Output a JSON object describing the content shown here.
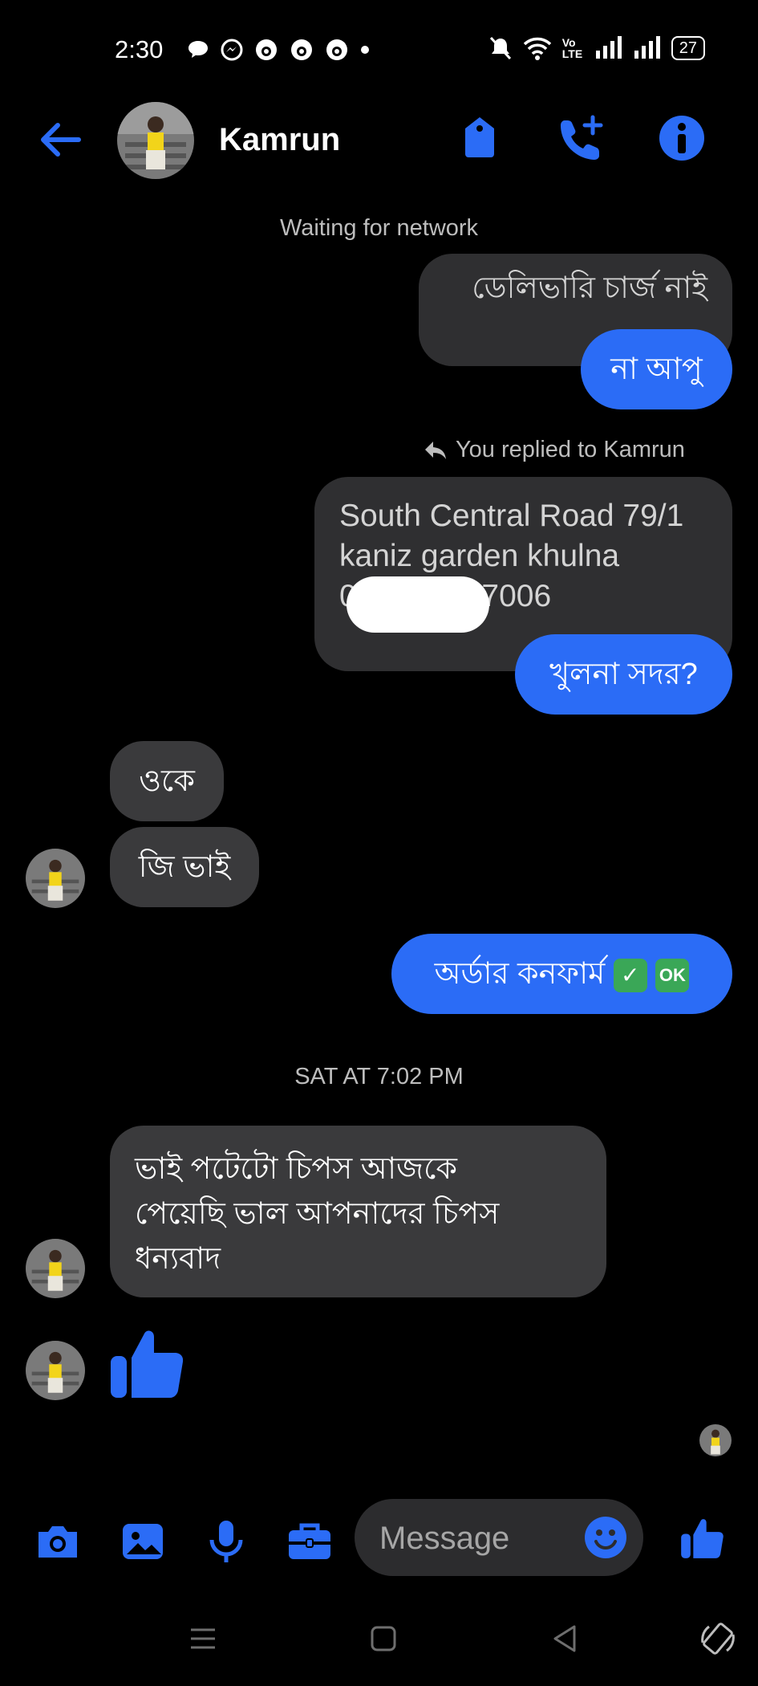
{
  "status_bar": {
    "time": "2:30",
    "battery": "27",
    "signal_label": "Vo LTE"
  },
  "header": {
    "contact_name": "Kamrun"
  },
  "network_status": "Waiting for network",
  "messages": [
    {
      "text": "ডেলিভারি চার্জ  নাই",
      "sender": "me"
    },
    {
      "text": "না আপু",
      "sender": "me"
    },
    {
      "reply_label": "You replied to Kamrun"
    },
    {
      "text_lines": [
        "South Central Road 79/1",
        "kaniz garden khulna",
        "01",
        "7006"
      ],
      "sender": "me"
    },
    {
      "text": "খুলনা সদর?",
      "sender": "me"
    },
    {
      "text": "ওকে",
      "sender": "Kamrun"
    },
    {
      "text": "জি ভাই",
      "sender": "Kamrun"
    },
    {
      "text": "অর্ডার কনফার্ম",
      "emoji_ok": "OK",
      "sender": "me"
    },
    {
      "timestamp": "SAT AT 7:02 PM"
    },
    {
      "text_lines": [
        "ভাই  পটেটো চিপস আজকে",
        "পেয়েছি ভাল আপনাদের চিপস",
        "ধন্যবাদ"
      ],
      "sender": "Kamrun"
    },
    {
      "sticker": "thumbs-up",
      "sender": "Kamrun"
    }
  ],
  "composer": {
    "placeholder": "Message"
  },
  "colors": {
    "accent": "#2b6cf6",
    "incoming_bubble": "#3a3a3c",
    "outgoing_grey_bubble": "#2f2f31",
    "background": "#000000"
  },
  "icons": {
    "header": [
      "back-arrow-icon",
      "tag-icon",
      "add-call-icon",
      "info-icon"
    ],
    "composer": [
      "camera-icon",
      "gallery-icon",
      "microphone-icon",
      "briefcase-icon",
      "emoji-icon",
      "thumbs-up-icon"
    ],
    "nav": [
      "menu-icon",
      "home-icon",
      "back-icon",
      "rotate-icon"
    ]
  }
}
